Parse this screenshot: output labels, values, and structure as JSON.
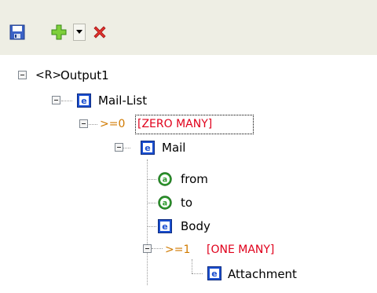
{
  "toolbar": {
    "buttons": [
      {
        "icon": "save-icon",
        "label": ""
      },
      {
        "icon": "add-icon",
        "label": ""
      },
      {
        "icon": "dropdown-arrow-icon",
        "label": ""
      },
      {
        "icon": "delete-icon",
        "label": ""
      }
    ]
  },
  "tree": {
    "root": {
      "prefix": "<R>",
      "label": "Output1"
    },
    "mail_list": {
      "badge": "e",
      "label": "Mail-List"
    },
    "zero_many": {
      "op": ">=0",
      "label": "[ZERO MANY]"
    },
    "mail": {
      "badge": "e",
      "label": "Mail"
    },
    "from": {
      "badge": "a",
      "label": "from"
    },
    "to": {
      "badge": "a",
      "label": "to"
    },
    "body": {
      "badge": "e",
      "label": "Body"
    },
    "one_many": {
      "op": ">=1",
      "label": "[ONE MANY]"
    },
    "attachment": {
      "badge": "e",
      "label": "Attachment"
    }
  },
  "colors": {
    "toolbar_bg": "#eeeee4",
    "element_badge": "#1b4fd0",
    "attribute_badge": "#2f9a2f",
    "cardinality_label": "#e0001b",
    "operator": "#d07a00"
  }
}
